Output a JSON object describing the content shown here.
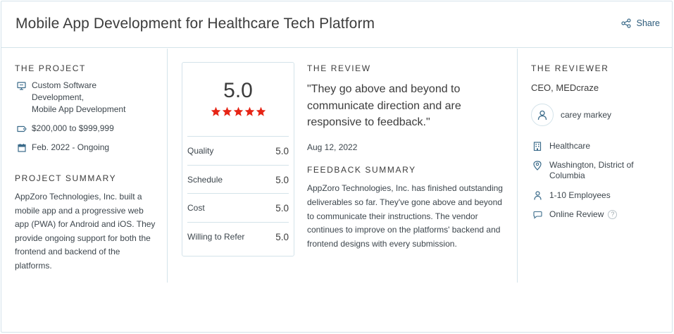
{
  "header": {
    "title": "Mobile App Development for Healthcare Tech Platform",
    "share_label": "Share"
  },
  "project": {
    "section_label": "THE PROJECT",
    "services": [
      "Custom Software",
      "Development,",
      "Mobile App Development"
    ],
    "budget": "$200,000 to $999,999",
    "dates": "Feb. 2022 - Ongoing",
    "summary_label": "PROJECT SUMMARY",
    "summary_text": "AppZoro Technologies, Inc. built a mobile app and a progressive web app (PWA) for Android and iOS. They provide ongoing support for both the frontend and backend of the platforms."
  },
  "rating": {
    "overall": "5.0",
    "stars": 5,
    "star_color": "#e62415",
    "metrics": [
      {
        "label": "Quality",
        "value": "5.0"
      },
      {
        "label": "Schedule",
        "value": "5.0"
      },
      {
        "label": "Cost",
        "value": "5.0"
      },
      {
        "label": "Willing to Refer",
        "value": "5.0"
      }
    ]
  },
  "review": {
    "section_label": "THE REVIEW",
    "quote": "\"They go above and beyond to communicate direction and are responsive to feedback.\"",
    "date": "Aug 12, 2022",
    "feedback_label": "FEEDBACK SUMMARY",
    "feedback_text": "AppZoro Technologies, Inc. has finished outstanding deliverables so far. They've gone above and beyond to communicate their instructions. The vendor continues to improve on the platforms' backend and frontend designs with every submission."
  },
  "reviewer": {
    "section_label": "THE REVIEWER",
    "role": "CEO, MEDcraze",
    "name": "carey markey",
    "industry": "Healthcare",
    "location_line1": "Washington, District of",
    "location_line2": "Columbia",
    "size": "1-10 Employees",
    "review_type": "Online Review",
    "help_glyph": "?"
  },
  "colors": {
    "border": "#d4e3ea",
    "link": "#2b5a7a",
    "icon": "#3b6b8a",
    "star": "#e62415"
  }
}
